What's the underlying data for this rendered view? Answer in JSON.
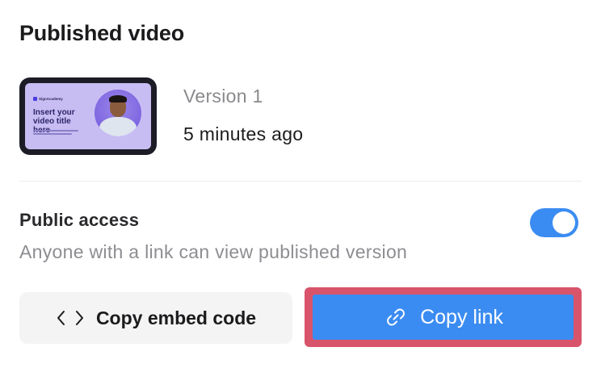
{
  "panel": {
    "title": "Published video"
  },
  "video": {
    "version": "Version 1",
    "published_time": "5 minutes ago",
    "thumbnail": {
      "logo_text": "SignAcademy",
      "title": "Insert your video title here"
    }
  },
  "access": {
    "title": "Public access",
    "description": "Anyone with a link can view published version",
    "enabled": true
  },
  "actions": {
    "embed_label": "Copy embed code",
    "copy_link_label": "Copy link"
  },
  "colors": {
    "accent": "#3b8cf2",
    "highlight": "#d8546a",
    "thumbnail_bg": "#c8bdf3"
  },
  "icons": {
    "embed": "code-brackets-icon",
    "link": "link-chain-icon"
  }
}
